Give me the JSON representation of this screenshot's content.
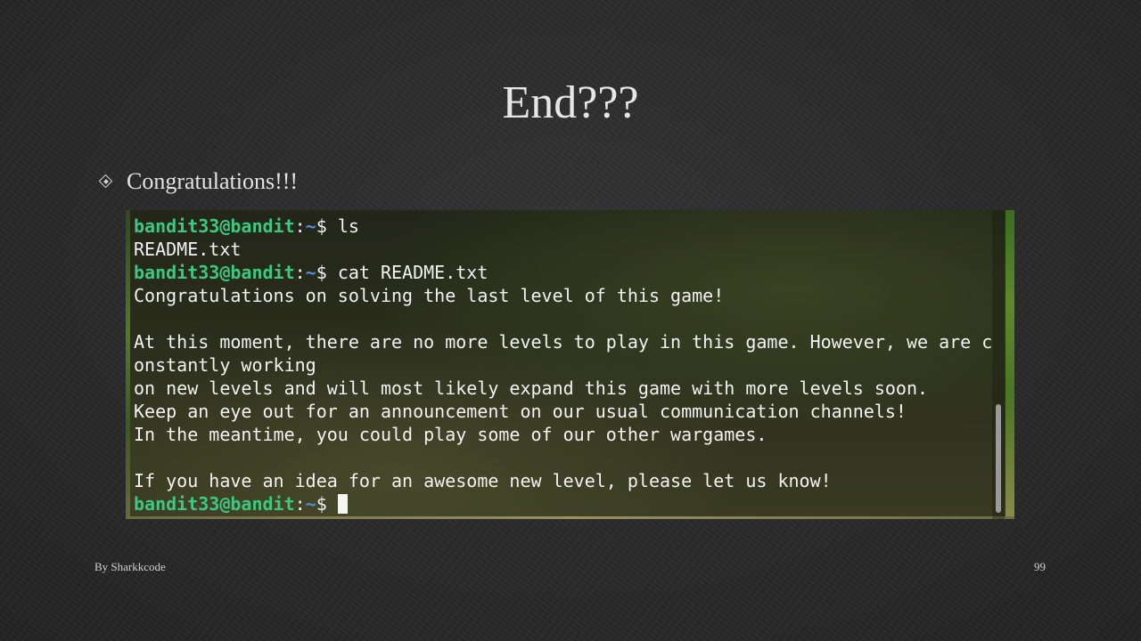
{
  "slide": {
    "title": "End???",
    "bullet": "Congratulations!!!",
    "footer_author": "By Sharkkcode",
    "page_number": "99"
  },
  "terminal": {
    "prompt_user": "bandit33@bandit",
    "prompt_colon": ":",
    "prompt_path": "~",
    "prompt_symbol": "$ ",
    "lines": [
      {
        "type": "cmd",
        "text": "ls"
      },
      {
        "type": "out",
        "text": "README.txt"
      },
      {
        "type": "cmd",
        "text": "cat README.txt"
      },
      {
        "type": "out",
        "text": "Congratulations on solving the last level of this game!"
      },
      {
        "type": "out",
        "text": ""
      },
      {
        "type": "out",
        "text": "At this moment, there are no more levels to play in this game. However, we are c"
      },
      {
        "type": "out",
        "text": "onstantly working"
      },
      {
        "type": "out",
        "text": "on new levels and will most likely expand this game with more levels soon."
      },
      {
        "type": "out",
        "text": "Keep an eye out for an announcement on our usual communication channels!"
      },
      {
        "type": "out",
        "text": "In the meantime, you could play some of our other wargames."
      },
      {
        "type": "out",
        "text": ""
      },
      {
        "type": "out",
        "text": "If you have an idea for an awesome new level, please let us know!"
      },
      {
        "type": "prompt",
        "text": ""
      }
    ]
  },
  "colors": {
    "prompt_user": "#3fc77f",
    "prompt_path": "#4f8fe0",
    "terminal_text": "#f2f2f2",
    "slide_background": "#2a2a2a"
  }
}
